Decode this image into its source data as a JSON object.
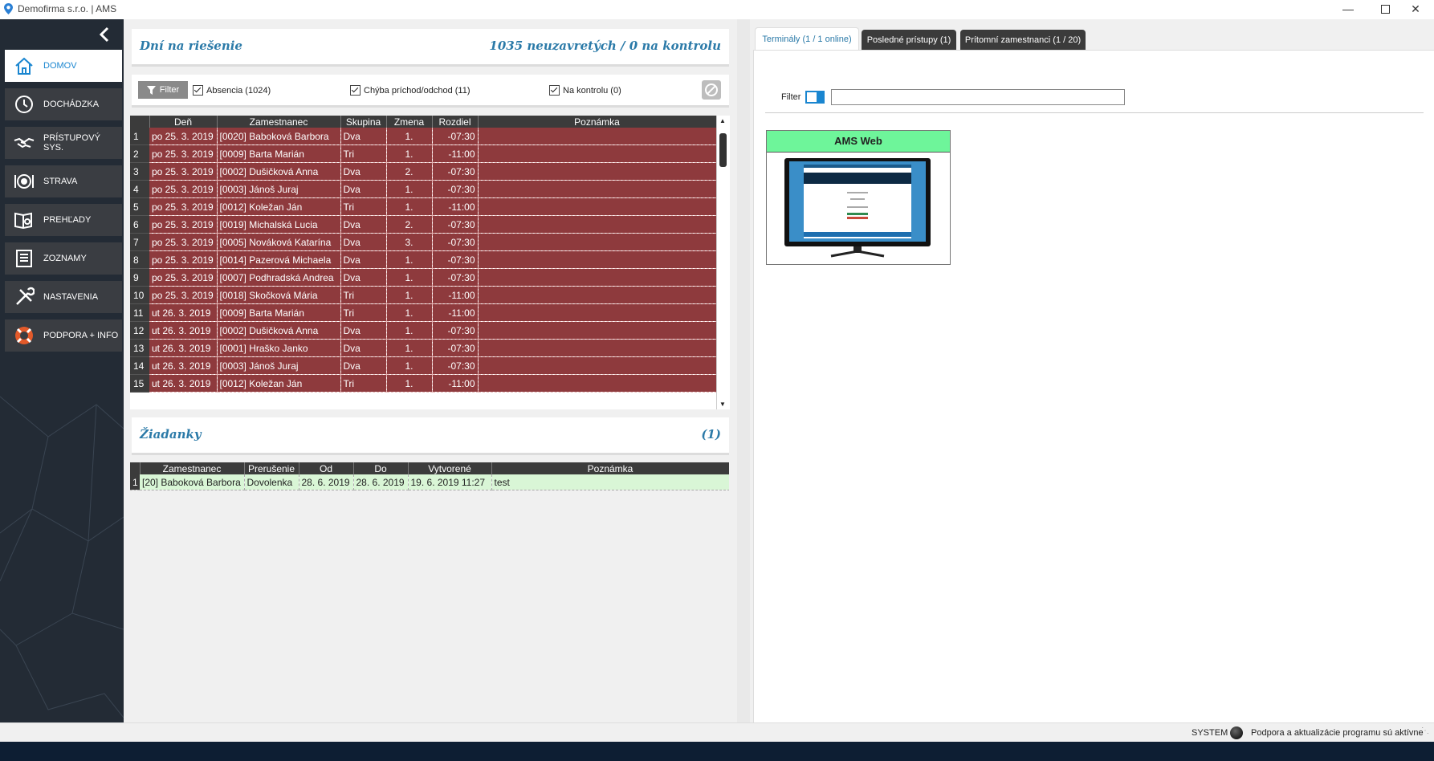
{
  "window": {
    "title": "Demofirma s.r.o. | AMS",
    "minimize_icon": "minimize-icon",
    "maximize_icon": "maximize-icon",
    "close_icon": "close-icon"
  },
  "sidebar": {
    "items": [
      {
        "label": "DOMOV",
        "icon": "home-icon",
        "active": true
      },
      {
        "label": "DOCHÁDZKA",
        "icon": "clock-icon"
      },
      {
        "label": "PRÍSTUPOVÝ SYS.",
        "icon": "handshake-icon"
      },
      {
        "label": "STRAVA",
        "icon": "plate-icon"
      },
      {
        "label": "PREHĽADY",
        "icon": "book-search-icon"
      },
      {
        "label": "ZOZNAMY",
        "icon": "list-icon"
      },
      {
        "label": "NASTAVENIA",
        "icon": "tools-icon"
      },
      {
        "label": "PODPORA + INFO",
        "icon": "lifebuoy-icon"
      }
    ]
  },
  "issues": {
    "title": "Dní na riešenie",
    "summary": "1035 neuzavretých / 0 na kontrolu",
    "filter_label": "Filter",
    "checks": [
      {
        "label": "Absencia (1024)",
        "checked": true
      },
      {
        "label": "Chýba príchod/odchod (11)",
        "checked": true
      },
      {
        "label": "Na kontrolu (0)",
        "checked": true
      }
    ],
    "columns": [
      "Deň",
      "Zamestnanec",
      "Skupina",
      "Zmena",
      "Rozdiel",
      "Poznámka"
    ],
    "rows": [
      [
        "1",
        "po 25. 3. 2019",
        "[0020] Baboková Barbora",
        "Dva",
        "1.",
        "-07:30",
        ""
      ],
      [
        "2",
        "po 25. 3. 2019",
        "[0009] Barta Marián",
        "Tri",
        "1.",
        "-11:00",
        ""
      ],
      [
        "3",
        "po 25. 3. 2019",
        "[0002] Dušičková Anna",
        "Dva",
        "2.",
        "-07:30",
        ""
      ],
      [
        "4",
        "po 25. 3. 2019",
        "[0003] Jánoš Juraj",
        "Dva",
        "1.",
        "-07:30",
        ""
      ],
      [
        "5",
        "po 25. 3. 2019",
        "[0012] Koležan Ján",
        "Tri",
        "1.",
        "-11:00",
        ""
      ],
      [
        "6",
        "po 25. 3. 2019",
        "[0019] Michalská Lucia",
        "Dva",
        "2.",
        "-07:30",
        ""
      ],
      [
        "7",
        "po 25. 3. 2019",
        "[0005] Nováková Katarína",
        "Dva",
        "3.",
        "-07:30",
        ""
      ],
      [
        "8",
        "po 25. 3. 2019",
        "[0014] Pazerová Michaela",
        "Dva",
        "1.",
        "-07:30",
        ""
      ],
      [
        "9",
        "po 25. 3. 2019",
        "[0007] Podhradská Andrea",
        "Dva",
        "1.",
        "-07:30",
        ""
      ],
      [
        "10",
        "po 25. 3. 2019",
        "[0018] Skočková Mária",
        "Tri",
        "1.",
        "-11:00",
        ""
      ],
      [
        "11",
        "ut 26. 3. 2019",
        "[0009] Barta Marián",
        "Tri",
        "1.",
        "-11:00",
        ""
      ],
      [
        "12",
        "ut 26. 3. 2019",
        "[0002] Dušičková Anna",
        "Dva",
        "1.",
        "-07:30",
        ""
      ],
      [
        "13",
        "ut 26. 3. 2019",
        "[0001] Hraško Janko",
        "Dva",
        "1.",
        "-07:30",
        ""
      ],
      [
        "14",
        "ut 26. 3. 2019",
        "[0003] Jánoš Juraj",
        "Dva",
        "1.",
        "-07:30",
        ""
      ],
      [
        "15",
        "ut 26. 3. 2019",
        "[0012] Koležan Ján",
        "Tri",
        "1.",
        "-11:00",
        ""
      ]
    ],
    "row_color": "#8e3a3d"
  },
  "requests": {
    "title": "Žiadanky",
    "count": "(1)",
    "columns": [
      "Zamestnanec",
      "Prerušenie",
      "Od",
      "Do",
      "Vytvorené",
      "Poznámka"
    ],
    "rows": [
      [
        "1",
        "[20] Baboková Barbora",
        "Dovolenka",
        "28. 6. 2019",
        "28. 6. 2019",
        "19. 6. 2019  11:27",
        "test"
      ]
    ],
    "row_color": "#d9f6d6"
  },
  "right": {
    "tabs": [
      {
        "label": "Terminály (1 / 1 online)",
        "active": true
      },
      {
        "label": "Posledné prístupy (1)"
      },
      {
        "label": "Prítomní zamestnanci (1 / 20)"
      }
    ],
    "filter_label": "Filter",
    "filter_value": "",
    "terminal": {
      "name": "AMS Web",
      "header_color": "#6ef59a"
    }
  },
  "status": {
    "user": "SYSTEM",
    "message": "Podpora a aktualizácie programu sú aktívne"
  }
}
